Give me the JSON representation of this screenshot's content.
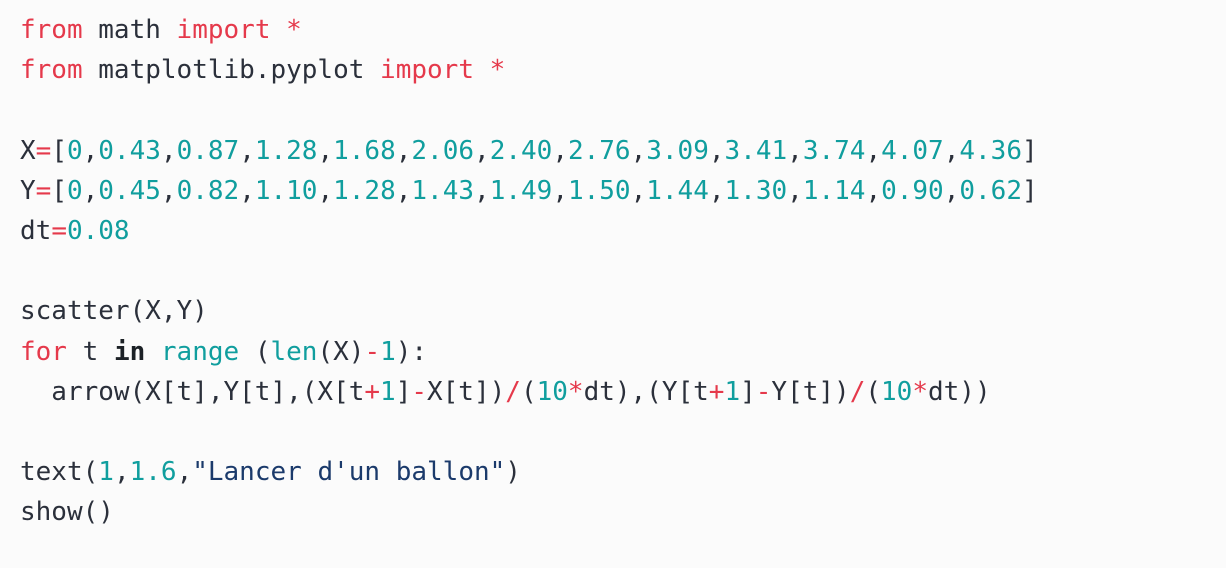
{
  "editor": {
    "language": "python",
    "background_color": "#fbfbfb",
    "colors": {
      "plain": "#2b303b",
      "keyword": "#e5394b",
      "keyword_bold": "#1c2126",
      "operator": "#e5394b",
      "number": "#109e9e",
      "builtin": "#109e9e",
      "string": "#1b3a6b"
    }
  },
  "code": {
    "full_text": "from math import *\nfrom matplotlib.pyplot import *\n\nX=[0,0.43,0.87,1.28,1.68,2.06,2.40,2.76,3.09,3.41,3.74,4.07,4.36]\nY=[0,0.45,0.82,1.10,1.28,1.43,1.49,1.50,1.44,1.30,1.14,0.90,0.62]\ndt=0.08\n\nscatter(X,Y)\nfor t in range (len(X)-1):\n  arrow(X[t],Y[t],(X[t+1]-X[t])/(10*dt),(Y[t+1]-Y[t])/(10*dt))\n\ntext(1,1.6,\"Lancer d'un ballon\")\nshow()",
    "lines": [
      {
        "n": 1,
        "text": "from math import *",
        "tokens": [
          {
            "t": "from",
            "c": "kw"
          },
          {
            "t": " math ",
            "c": "plain"
          },
          {
            "t": "import",
            "c": "kw"
          },
          {
            "t": " ",
            "c": "plain"
          },
          {
            "t": "*",
            "c": "kw"
          }
        ]
      },
      {
        "n": 2,
        "text": "from matplotlib.pyplot import *",
        "tokens": [
          {
            "t": "from",
            "c": "kw"
          },
          {
            "t": " matplotlib.pyplot ",
            "c": "plain"
          },
          {
            "t": "import",
            "c": "kw"
          },
          {
            "t": " ",
            "c": "plain"
          },
          {
            "t": "*",
            "c": "kw"
          }
        ]
      },
      {
        "n": 3,
        "text": "",
        "tokens": []
      },
      {
        "n": 4,
        "text": "X=[0,0.43,0.87,1.28,1.68,2.06,2.40,2.76,3.09,3.41,3.74,4.07,4.36]",
        "tokens": [
          {
            "t": "X",
            "c": "plain"
          },
          {
            "t": "=",
            "c": "op"
          },
          {
            "t": "[",
            "c": "punct"
          },
          {
            "t": "0",
            "c": "num"
          },
          {
            "t": ",",
            "c": "punct"
          },
          {
            "t": "0.43",
            "c": "num"
          },
          {
            "t": ",",
            "c": "punct"
          },
          {
            "t": "0.87",
            "c": "num"
          },
          {
            "t": ",",
            "c": "punct"
          },
          {
            "t": "1.28",
            "c": "num"
          },
          {
            "t": ",",
            "c": "punct"
          },
          {
            "t": "1.68",
            "c": "num"
          },
          {
            "t": ",",
            "c": "punct"
          },
          {
            "t": "2.06",
            "c": "num"
          },
          {
            "t": ",",
            "c": "punct"
          },
          {
            "t": "2.40",
            "c": "num"
          },
          {
            "t": ",",
            "c": "punct"
          },
          {
            "t": "2.76",
            "c": "num"
          },
          {
            "t": ",",
            "c": "punct"
          },
          {
            "t": "3.09",
            "c": "num"
          },
          {
            "t": ",",
            "c": "punct"
          },
          {
            "t": "3.41",
            "c": "num"
          },
          {
            "t": ",",
            "c": "punct"
          },
          {
            "t": "3.74",
            "c": "num"
          },
          {
            "t": ",",
            "c": "punct"
          },
          {
            "t": "4.07",
            "c": "num"
          },
          {
            "t": ",",
            "c": "punct"
          },
          {
            "t": "4.36",
            "c": "num"
          },
          {
            "t": "]",
            "c": "punct"
          }
        ]
      },
      {
        "n": 5,
        "text": "Y=[0,0.45,0.82,1.10,1.28,1.43,1.49,1.50,1.44,1.30,1.14,0.90,0.62]",
        "tokens": [
          {
            "t": "Y",
            "c": "plain"
          },
          {
            "t": "=",
            "c": "op"
          },
          {
            "t": "[",
            "c": "punct"
          },
          {
            "t": "0",
            "c": "num"
          },
          {
            "t": ",",
            "c": "punct"
          },
          {
            "t": "0.45",
            "c": "num"
          },
          {
            "t": ",",
            "c": "punct"
          },
          {
            "t": "0.82",
            "c": "num"
          },
          {
            "t": ",",
            "c": "punct"
          },
          {
            "t": "1.10",
            "c": "num"
          },
          {
            "t": ",",
            "c": "punct"
          },
          {
            "t": "1.28",
            "c": "num"
          },
          {
            "t": ",",
            "c": "punct"
          },
          {
            "t": "1.43",
            "c": "num"
          },
          {
            "t": ",",
            "c": "punct"
          },
          {
            "t": "1.49",
            "c": "num"
          },
          {
            "t": ",",
            "c": "punct"
          },
          {
            "t": "1.50",
            "c": "num"
          },
          {
            "t": ",",
            "c": "punct"
          },
          {
            "t": "1.44",
            "c": "num"
          },
          {
            "t": ",",
            "c": "punct"
          },
          {
            "t": "1.30",
            "c": "num"
          },
          {
            "t": ",",
            "c": "punct"
          },
          {
            "t": "1.14",
            "c": "num"
          },
          {
            "t": ",",
            "c": "punct"
          },
          {
            "t": "0.90",
            "c": "num"
          },
          {
            "t": ",",
            "c": "punct"
          },
          {
            "t": "0.62",
            "c": "num"
          },
          {
            "t": "]",
            "c": "punct"
          }
        ]
      },
      {
        "n": 6,
        "text": "dt=0.08",
        "tokens": [
          {
            "t": "dt",
            "c": "plain"
          },
          {
            "t": "=",
            "c": "op"
          },
          {
            "t": "0.08",
            "c": "num"
          }
        ]
      },
      {
        "n": 7,
        "text": "",
        "tokens": []
      },
      {
        "n": 8,
        "text": "scatter(X,Y)",
        "tokens": [
          {
            "t": "scatter(X,Y)",
            "c": "plain"
          }
        ]
      },
      {
        "n": 9,
        "text": "for t in range (len(X)-1):",
        "tokens": [
          {
            "t": "for",
            "c": "kw"
          },
          {
            "t": " t ",
            "c": "plain"
          },
          {
            "t": "in",
            "c": "kw-bold"
          },
          {
            "t": " ",
            "c": "plain"
          },
          {
            "t": "range",
            "c": "builtin"
          },
          {
            "t": " (",
            "c": "punct"
          },
          {
            "t": "len",
            "c": "builtin"
          },
          {
            "t": "(X)",
            "c": "punct"
          },
          {
            "t": "-",
            "c": "op"
          },
          {
            "t": "1",
            "c": "num"
          },
          {
            "t": "):",
            "c": "punct"
          }
        ]
      },
      {
        "n": 10,
        "text": "  arrow(X[t],Y[t],(X[t+1]-X[t])/(10*dt),(Y[t+1]-Y[t])/(10*dt))",
        "tokens": [
          {
            "t": "  arrow(X[t],Y[t],(X[t",
            "c": "plain"
          },
          {
            "t": "+",
            "c": "op"
          },
          {
            "t": "1",
            "c": "num"
          },
          {
            "t": "]",
            "c": "plain"
          },
          {
            "t": "-",
            "c": "op"
          },
          {
            "t": "X[t])",
            "c": "plain"
          },
          {
            "t": "/",
            "c": "op"
          },
          {
            "t": "(",
            "c": "plain"
          },
          {
            "t": "10",
            "c": "num"
          },
          {
            "t": "*",
            "c": "op"
          },
          {
            "t": "dt),(Y[t",
            "c": "plain"
          },
          {
            "t": "+",
            "c": "op"
          },
          {
            "t": "1",
            "c": "num"
          },
          {
            "t": "]",
            "c": "plain"
          },
          {
            "t": "-",
            "c": "op"
          },
          {
            "t": "Y[t])",
            "c": "plain"
          },
          {
            "t": "/",
            "c": "op"
          },
          {
            "t": "(",
            "c": "plain"
          },
          {
            "t": "10",
            "c": "num"
          },
          {
            "t": "*",
            "c": "op"
          },
          {
            "t": "dt))",
            "c": "plain"
          }
        ]
      },
      {
        "n": 11,
        "text": "",
        "tokens": []
      },
      {
        "n": 12,
        "text": "text(1,1.6,\"Lancer d'un ballon\")",
        "tokens": [
          {
            "t": "text(",
            "c": "plain"
          },
          {
            "t": "1",
            "c": "num"
          },
          {
            "t": ",",
            "c": "plain"
          },
          {
            "t": "1.6",
            "c": "num"
          },
          {
            "t": ",",
            "c": "plain"
          },
          {
            "t": "\"Lancer d'un ballon\"",
            "c": "str"
          },
          {
            "t": ")",
            "c": "plain"
          }
        ]
      },
      {
        "n": 13,
        "text": "show()",
        "tokens": [
          {
            "t": "show()",
            "c": "plain"
          }
        ]
      }
    ]
  },
  "chart_data": {
    "type": "scatter",
    "title": "Lancer d'un ballon",
    "xlabel": "",
    "ylabel": "",
    "x": [
      0,
      0.43,
      0.87,
      1.28,
      1.68,
      2.06,
      2.4,
      2.76,
      3.09,
      3.41,
      3.74,
      4.07,
      4.36
    ],
    "y": [
      0,
      0.45,
      0.82,
      1.1,
      1.28,
      1.43,
      1.49,
      1.5,
      1.44,
      1.3,
      1.14,
      0.9,
      0.62
    ],
    "annotations": [
      {
        "text": "Lancer d'un ballon",
        "x": 1,
        "y": 1.6
      }
    ],
    "parameters": {
      "dt": 0.08,
      "arrow_scale": "1/(10*dt)"
    }
  }
}
